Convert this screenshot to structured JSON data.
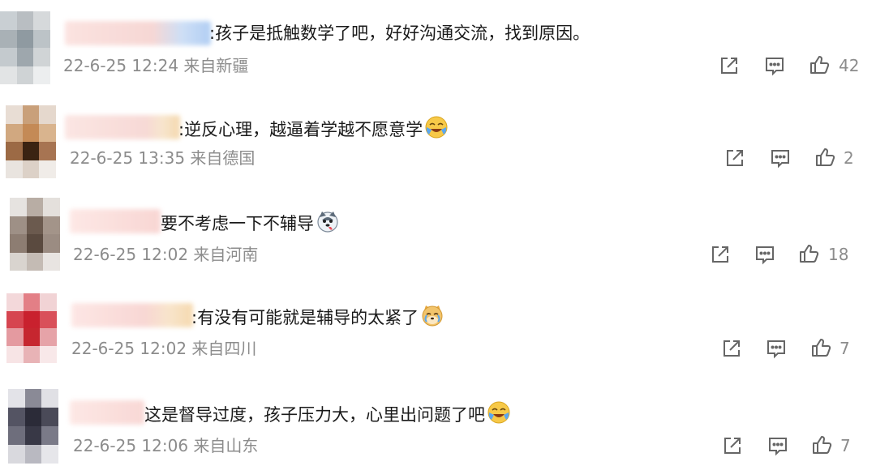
{
  "comments": [
    {
      "text": ":孩子是抵触数学了吧，好好沟通交流，找到原因。",
      "timestamp": "22-6-25 12:24",
      "location": "来自新疆",
      "likes": "42",
      "emoji": ""
    },
    {
      "text": ":逆反心理，越逼着学越不愿意学",
      "timestamp": "22-6-25 13:35",
      "location": "来自德国",
      "likes": "2",
      "emoji": "laughing-crying-emoji"
    },
    {
      "text": "要不考虑一下不辅导",
      "timestamp": "22-6-25 12:02",
      "location": "来自河南",
      "likes": "18",
      "emoji": "husky-emoji"
    },
    {
      "text": ":有没有可能就是辅导的太紧了",
      "timestamp": "22-6-25 12:02",
      "location": "来自四川",
      "likes": "7",
      "emoji": "doge-crying-emoji"
    },
    {
      "text": "这是督导过度，孩子压力大，心里出问题了吧",
      "timestamp": "22-6-25 12:06",
      "location": "来自山东",
      "likes": "7",
      "emoji": "laughing-crying-emoji"
    }
  ],
  "icons": {
    "share": "share-icon",
    "comment": "comment-icon",
    "like": "thumbs-up-icon"
  },
  "colors": {
    "text": "#1a1a1a",
    "meta": "#8c8c8c",
    "icon": "#666666"
  }
}
